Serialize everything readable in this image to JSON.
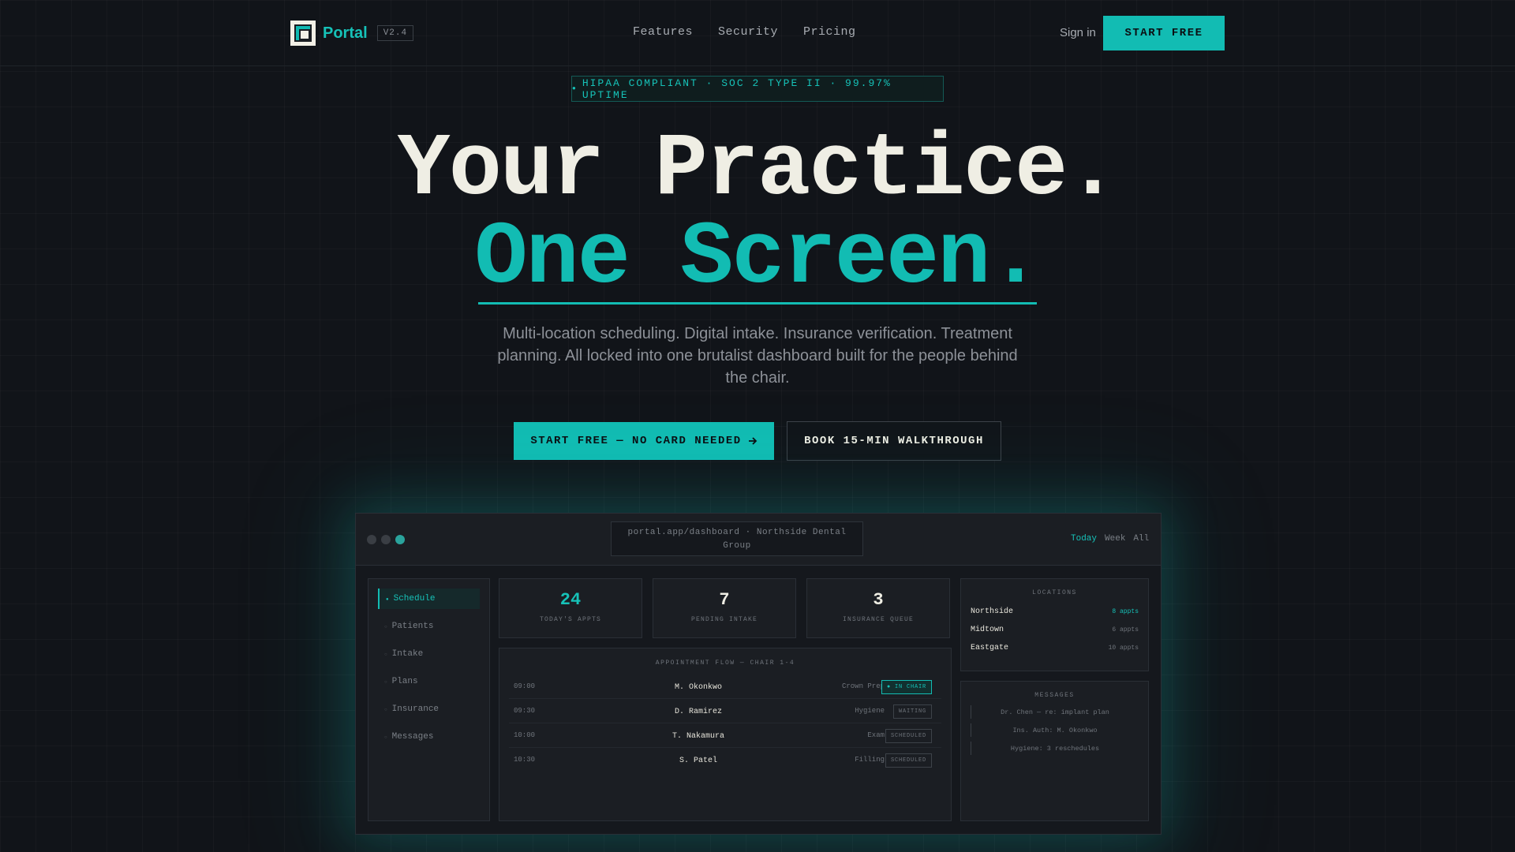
{
  "nav": {
    "brand": "Portal",
    "version": "V2.4",
    "links": [
      "Features",
      "Security",
      "Pricing"
    ],
    "sign_in": "Sign in",
    "cta": "START FREE"
  },
  "hero": {
    "badge": "HIPAA COMPLIANT · SOC 2 TYPE II · 99.97% UPTIME",
    "headline_1": "Your Practice.",
    "headline_2": "One Screen.",
    "subtitle": "Multi-location scheduling. Digital intake. Insurance verification. Treatment planning. All locked into one brutalist dashboard built for the people behind the chair.",
    "primary_cta": "START FREE — NO CARD NEEDED",
    "secondary_cta": "BOOK 15-MIN WALKTHROUGH"
  },
  "dashboard": {
    "url": "portal.app/dashboard · Northside Dental Group",
    "view_tabs": [
      "Today",
      "Week",
      "All"
    ],
    "active_view": "Today",
    "sidebar": [
      "Schedule",
      "Patients",
      "Intake",
      "Plans",
      "Insurance",
      "Messages"
    ],
    "active_sidebar": "Schedule",
    "stats": [
      {
        "value": "24",
        "label": "TODAY'S APPTS"
      },
      {
        "value": "7",
        "label": "PENDING INTAKE"
      },
      {
        "value": "3",
        "label": "INSURANCE QUEUE"
      }
    ],
    "flow_title": "APPOINTMENT FLOW — CHAIR 1-4",
    "appointments": [
      {
        "time": "09:00",
        "patient": "M. Okonkwo",
        "type": "Crown Prep",
        "status": "● IN CHAIR"
      },
      {
        "time": "09:30",
        "patient": "D. Ramirez",
        "type": "Hygiene",
        "status": "WAITING"
      },
      {
        "time": "10:00",
        "patient": "T. Nakamura",
        "type": "Exam",
        "status": "SCHEDULED"
      },
      {
        "time": "10:30",
        "patient": "S. Patel",
        "type": "Filling",
        "status": "SCHEDULED"
      }
    ],
    "locations_title": "LOCATIONS",
    "locations": [
      {
        "name": "Northside",
        "count": "8 appts"
      },
      {
        "name": "Midtown",
        "count": "6 appts"
      },
      {
        "name": "Eastgate",
        "count": "10 appts"
      }
    ],
    "messages_title": "MESSAGES",
    "messages": [
      "Dr. Chen — re: implant plan",
      "Ins. Auth: M. Okonkwo",
      "Hygiene: 3 reschedules"
    ]
  },
  "colors": {
    "accent": "#12bcb3",
    "background": "#111419",
    "headline": "#efeee4"
  }
}
